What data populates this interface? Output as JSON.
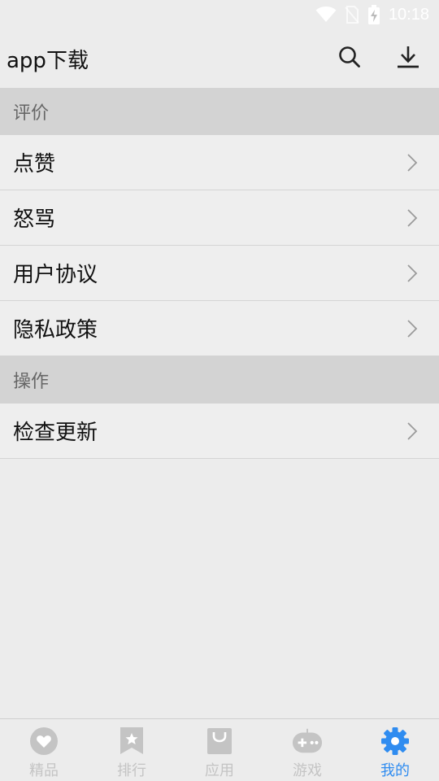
{
  "status_bar": {
    "time": "10:18",
    "icons": [
      "wifi-icon",
      "no-sim-icon",
      "battery-charging-icon"
    ]
  },
  "app_bar": {
    "title": "app下载",
    "actions": [
      "search-icon",
      "download-icon"
    ]
  },
  "sections": [
    {
      "header": "评价",
      "items": [
        {
          "label": "点赞"
        },
        {
          "label": "怒骂"
        },
        {
          "label": "用户协议"
        },
        {
          "label": "隐私政策"
        }
      ]
    },
    {
      "header": "操作",
      "items": [
        {
          "label": "检查更新"
        }
      ]
    }
  ],
  "bottom_nav": {
    "items": [
      {
        "label": "精品",
        "icon": "heart-icon"
      },
      {
        "label": "排行",
        "icon": "bookmark-star-icon"
      },
      {
        "label": "应用",
        "icon": "shopping-bag-icon"
      },
      {
        "label": "游戏",
        "icon": "gamepad-icon"
      },
      {
        "label": "我的",
        "icon": "gear-icon"
      }
    ],
    "active_index": 4
  },
  "colors": {
    "background": "#ececec",
    "section_header": "#d3d3d3",
    "accent": "#2f8cf0",
    "inactive_icon": "#c4c4c4"
  }
}
